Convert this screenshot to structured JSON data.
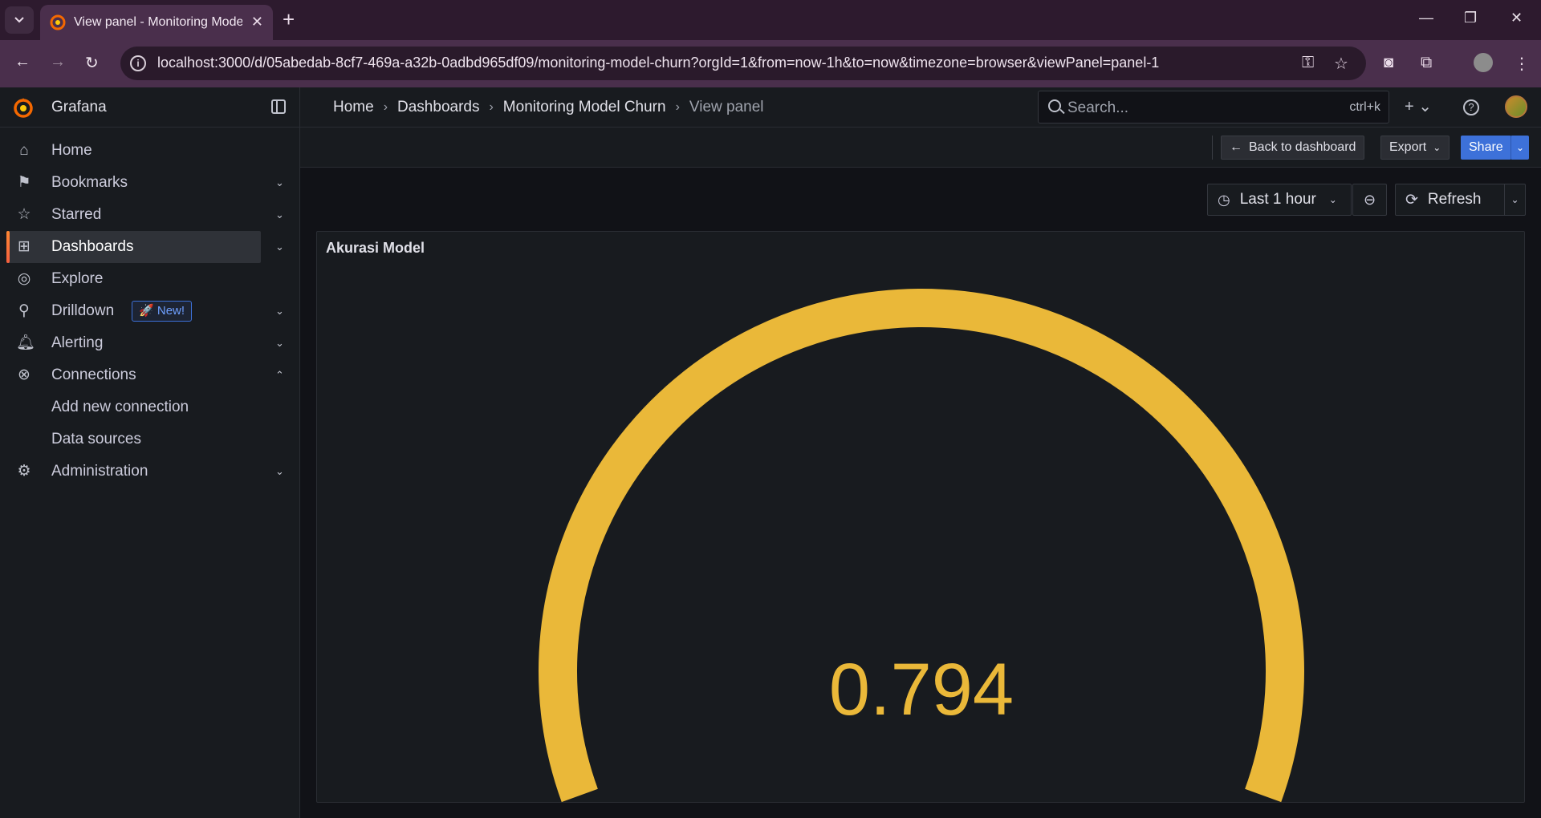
{
  "browser": {
    "tab_title": "View panel - Monitoring Model Churn",
    "url": "localhost:3000/d/05abedab-8cf7-469a-a32b-0adbd965df09/monitoring-model-churn?orgId=1&from=now-1h&to=now&timezone=browser&viewPanel=panel-1"
  },
  "app": {
    "brand": "Grafana",
    "breadcrumb": [
      "Home",
      "Dashboards",
      "Monitoring Model Churn",
      "View panel"
    ],
    "search_placeholder": "Search...",
    "search_shortcut": "ctrl+k"
  },
  "sidebar": {
    "items": [
      {
        "label": "Home"
      },
      {
        "label": "Bookmarks"
      },
      {
        "label": "Starred"
      },
      {
        "label": "Dashboards"
      },
      {
        "label": "Explore"
      },
      {
        "label": "Drilldown",
        "badge": "New!"
      },
      {
        "label": "Alerting"
      },
      {
        "label": "Connections"
      },
      {
        "label": "Add new connection"
      },
      {
        "label": "Data sources"
      },
      {
        "label": "Administration"
      }
    ]
  },
  "toolbar": {
    "back_label": "Back to dashboard",
    "export_label": "Export",
    "share_label": "Share",
    "time_range": "Last 1 hour",
    "refresh_label": "Refresh"
  },
  "panel": {
    "title": "Akurasi Model",
    "value": 0.794,
    "display_value": "0.794",
    "color": "#EAB839"
  }
}
